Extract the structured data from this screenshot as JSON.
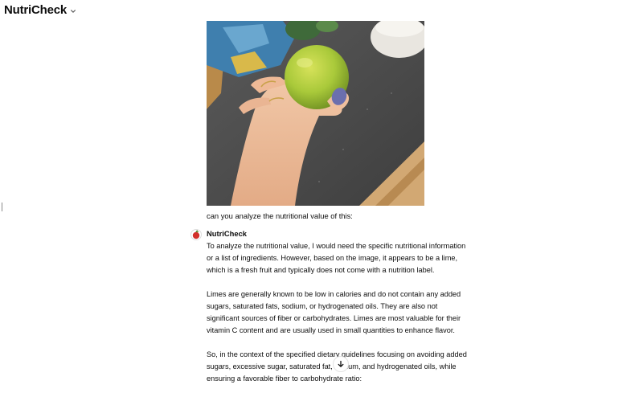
{
  "header": {
    "app_name": "NutriCheck",
    "model_menu_icon": "chevron-down-icon"
  },
  "conversation": {
    "user_image_icon": "uploaded-photo",
    "user_message": "can you analyze the nutritional value of this:",
    "assistant": {
      "name": "NutriCheck",
      "avatar_icon": "apple-avatar-icon",
      "paragraphs": [
        "To analyze the nutritional value, I would need the specific nutritional information or a list of ingredients. However, based on the image, it appears to be a lime, which is a fresh fruit and typically does not come with a nutrition label.",
        "Limes are generally known to be low in calories and do not contain any added sugars, saturated fats, sodium, or hydrogenated oils. They are also not significant sources of fiber or carbohydrates. Limes are most valuable for their vitamin C content and are usually used in small quantities to enhance flavor.",
        "So, in the context of the specified dietary guidelines focusing on avoiding added sugars, excessive sugar, saturated fat, sodium, and hydrogenated oils, while ensuring a favorable fiber to carbohydrate ratio:"
      ]
    }
  },
  "scroll_button_icon": "arrow-down-icon",
  "colors": {
    "text": "#0d0d0d",
    "background": "#ffffff",
    "nail_polish": "#6b6fae",
    "lime": "#a9c93a"
  }
}
